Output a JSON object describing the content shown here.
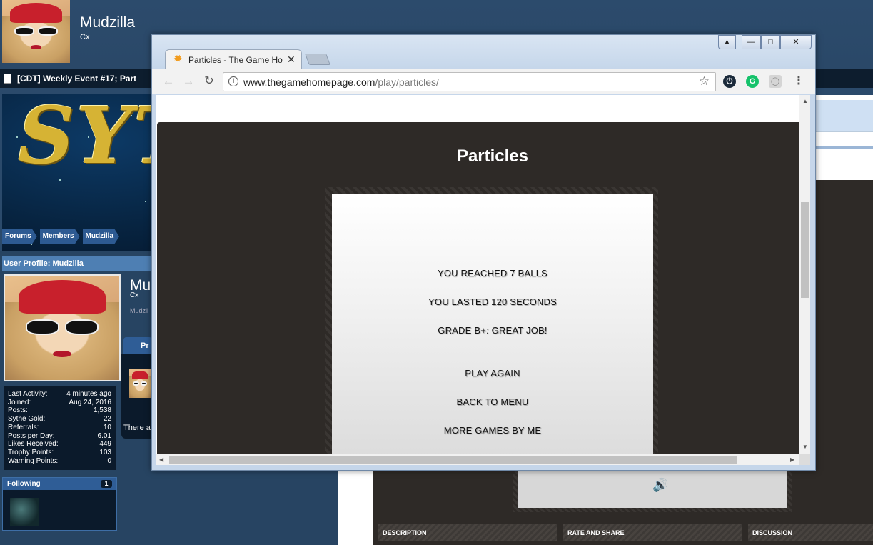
{
  "profile_header": {
    "username": "Mudzilla",
    "user_title": "Cx"
  },
  "thread_bar": {
    "title": "[CDT] Weekly Event #17; Part"
  },
  "breadcrumb": [
    "Forums",
    "Members",
    "Mudzilla"
  ],
  "profile": {
    "heading": "User Profile: Mudzilla",
    "name_partial": "Mu",
    "title_partial": "Cx",
    "sub_partial": "Mudzil",
    "tab_partial": "Pr",
    "panel_text_partial": "There a",
    "stats": [
      {
        "label": "Last Activity:",
        "value": "4 minutes ago"
      },
      {
        "label": "Joined:",
        "value": "Aug 24, 2016"
      },
      {
        "label": "Posts:",
        "value": "1,538"
      },
      {
        "label": "Sythe Gold:",
        "value": "22"
      },
      {
        "label": "Referrals:",
        "value": "10"
      },
      {
        "label": "Posts per Day:",
        "value": "6.01"
      },
      {
        "label": "Likes Received:",
        "value": "449"
      },
      {
        "label": "Trophy Points:",
        "value": "103"
      },
      {
        "label": "Warning Points:",
        "value": "0"
      }
    ],
    "following": {
      "label": "Following",
      "count": "1"
    }
  },
  "background_game": {
    "tabs": [
      "DESCRIPTION",
      "RATE AND SHARE",
      "DISCUSSION"
    ],
    "sound_icon": "speaker-icon"
  },
  "browser": {
    "tab_title": "Particles - The Game Homepage",
    "tab_icon": "sun-favicon",
    "url_host": "www.thegamehomepage.com",
    "url_path": "/play/particles/",
    "window_buttons": [
      "profile-icon",
      "minimize-icon",
      "maximize-icon",
      "close-icon"
    ],
    "extensions": [
      "power-icon",
      "grammarly-icon",
      "cube-icon"
    ]
  },
  "game": {
    "title": "Particles",
    "results": [
      "YOU REACHED 7 BALLS",
      "YOU LASTED 120 SECONDS",
      "GRADE B+: GREAT JOB!"
    ],
    "options": [
      "PLAY AGAIN",
      "BACK TO MENU",
      "MORE GAMES BY ME"
    ]
  },
  "colors": {
    "game_background": "#2e2a27",
    "page_header": "#2c4b6c",
    "link_blue": "#2d5a92"
  }
}
